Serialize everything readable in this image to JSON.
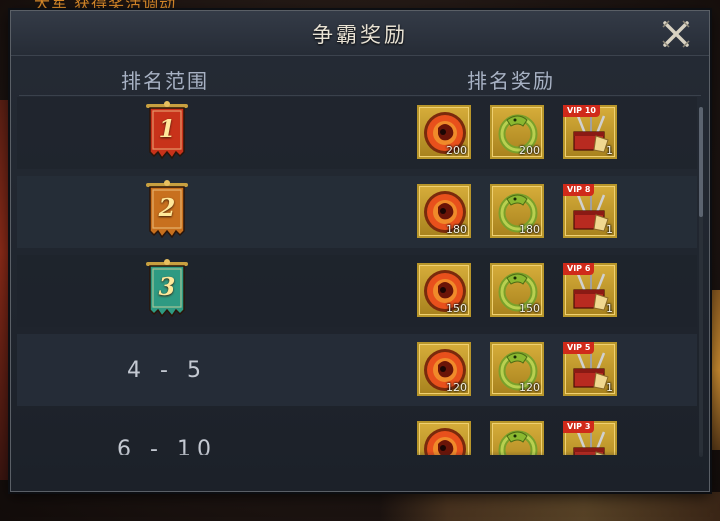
{
  "background": {
    "top_text": "大军 获得奖活调动"
  },
  "dialog": {
    "title": "争霸奖励",
    "col_rank": "排名范围",
    "col_reward": "排名奖励"
  },
  "rows": [
    {
      "rank": "1",
      "kind": "banner",
      "color": "#c8321a",
      "items": [
        {
          "type": "orb",
          "qty": "200"
        },
        {
          "type": "dragon",
          "qty": "200"
        },
        {
          "type": "chest",
          "vip": "VIP 10",
          "qty": "1"
        }
      ]
    },
    {
      "rank": "2",
      "kind": "banner",
      "color": "#c8701e",
      "items": [
        {
          "type": "orb",
          "qty": "180"
        },
        {
          "type": "dragon",
          "qty": "180"
        },
        {
          "type": "chest",
          "vip": "VIP 8",
          "qty": "1"
        }
      ]
    },
    {
      "rank": "3",
      "kind": "banner",
      "color": "#2e9a82",
      "items": [
        {
          "type": "orb",
          "qty": "150"
        },
        {
          "type": "dragon",
          "qty": "150"
        },
        {
          "type": "chest",
          "vip": "VIP 6",
          "qty": "1"
        }
      ]
    },
    {
      "rank": "4 - 5",
      "kind": "text",
      "items": [
        {
          "type": "orb",
          "qty": "120"
        },
        {
          "type": "dragon",
          "qty": "120"
        },
        {
          "type": "chest",
          "vip": "VIP 5",
          "qty": "1"
        }
      ]
    },
    {
      "rank": "6 - 10",
      "kind": "text",
      "items": [
        {
          "type": "orb",
          "qty": ""
        },
        {
          "type": "dragon",
          "qty": ""
        },
        {
          "type": "chest",
          "vip": "VIP 3",
          "qty": ""
        }
      ]
    }
  ]
}
